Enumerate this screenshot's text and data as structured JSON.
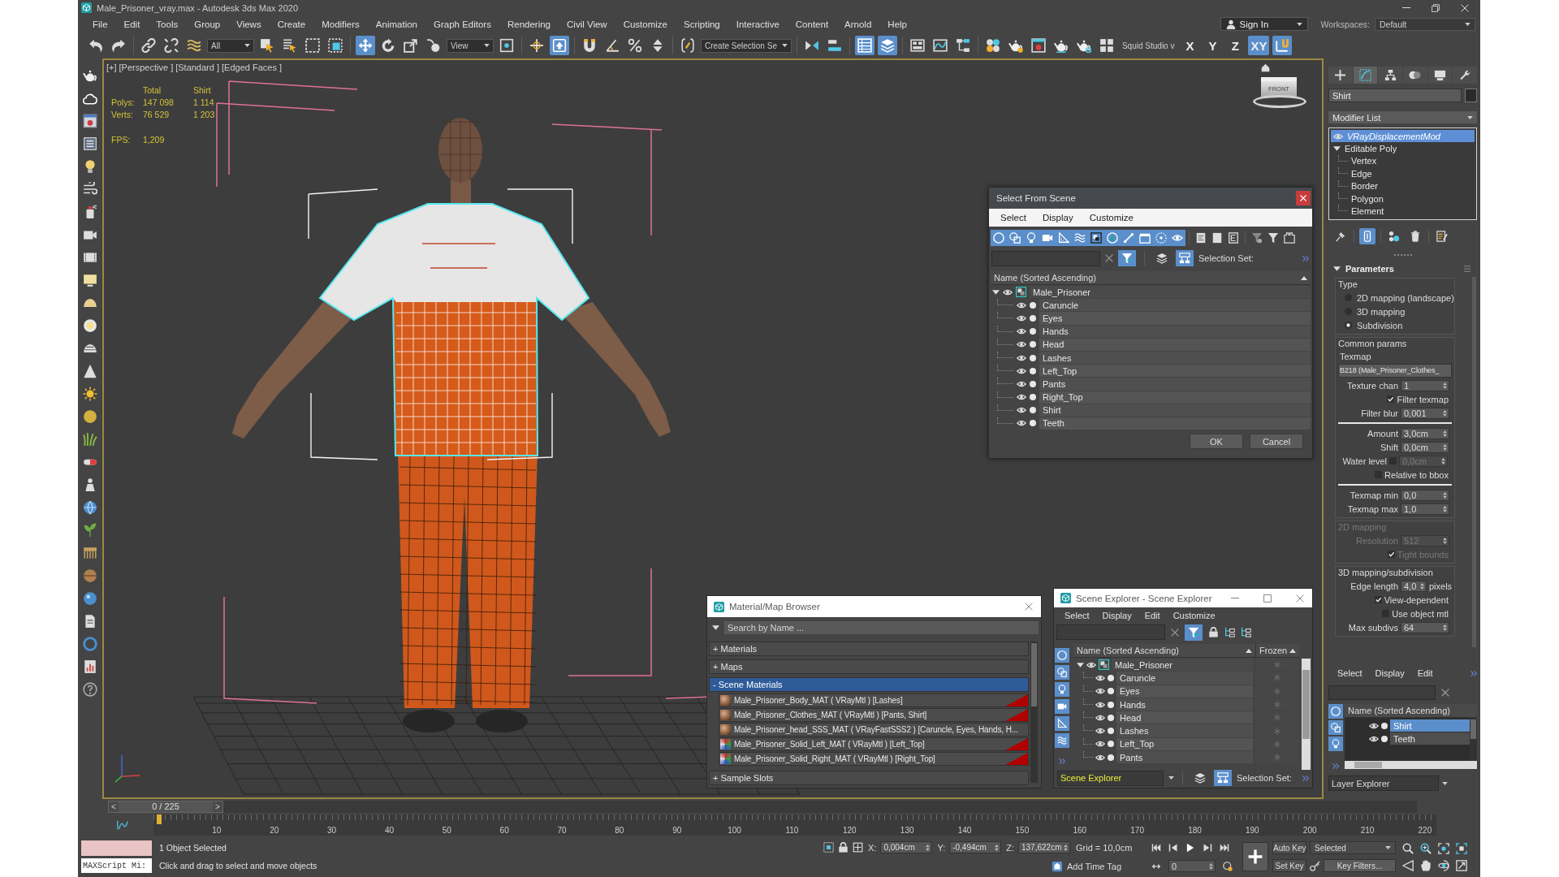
{
  "window": {
    "title": "Male_Prisoner_vray.max - Autodesk 3ds Max 2020"
  },
  "menu": [
    "File",
    "Edit",
    "Tools",
    "Group",
    "Views",
    "Create",
    "Modifiers",
    "Animation",
    "Graph Editors",
    "Rendering",
    "Civil View",
    "Customize",
    "Scripting",
    "Interactive",
    "Content",
    "Arnold",
    "Help"
  ],
  "account": {
    "label": "Sign In"
  },
  "workspaces": {
    "label": "Workspaces:",
    "value": "Default"
  },
  "main_toolbar": [
    {
      "kind": "icon",
      "on": false
    },
    {
      "kind": "icon",
      "on": false
    },
    {
      "kind": "separator"
    },
    {
      "kind": "icon",
      "on": false
    },
    {
      "kind": "icon",
      "on": false
    },
    {
      "kind": "icon",
      "on": false
    },
    {
      "kind": "dropdown",
      "value": "All"
    },
    {
      "kind": "icon",
      "on": false
    },
    {
      "kind": "icon",
      "on": false
    },
    {
      "kind": "icon",
      "on": false
    },
    {
      "kind": "icon",
      "on": false
    },
    {
      "kind": "separator"
    },
    {
      "kind": "icon",
      "on": true
    },
    {
      "kind": "icon",
      "on": false
    },
    {
      "kind": "icon",
      "on": false
    },
    {
      "kind": "icon",
      "on": false
    },
    {
      "kind": "dropdown",
      "value": "View"
    },
    {
      "kind": "icon",
      "on": false
    },
    {
      "kind": "separator"
    },
    {
      "kind": "icon",
      "on": false
    },
    {
      "kind": "icon",
      "on": true
    },
    {
      "kind": "separator"
    },
    {
      "kind": "icon",
      "on": false
    },
    {
      "kind": "icon",
      "on": false
    },
    {
      "kind": "icon",
      "on": false
    },
    {
      "kind": "icon",
      "on": false
    },
    {
      "kind": "separator"
    },
    {
      "kind": "icon",
      "on": false
    },
    {
      "kind": "dropdown",
      "value": "Create Selection Se"
    },
    {
      "kind": "separator"
    },
    {
      "kind": "icon",
      "on": false
    },
    {
      "kind": "icon",
      "on": false
    },
    {
      "kind": "separator"
    },
    {
      "kind": "icon",
      "on": true
    },
    {
      "kind": "icon",
      "on": true
    },
    {
      "kind": "separator"
    },
    {
      "kind": "icon",
      "on": false
    },
    {
      "kind": "icon",
      "on": false
    },
    {
      "kind": "icon",
      "on": false
    },
    {
      "kind": "separator"
    },
    {
      "kind": "icon",
      "on": false
    },
    {
      "kind": "icon",
      "on": false
    },
    {
      "kind": "icon",
      "on": false
    },
    {
      "kind": "icon",
      "on": false
    },
    {
      "kind": "icon",
      "on": false
    },
    {
      "kind": "icon",
      "on": false
    },
    {
      "kind": "label",
      "value": "Squid Studio v"
    },
    {
      "kind": "axis",
      "label": "X",
      "on": false
    },
    {
      "kind": "axis",
      "label": "Y",
      "on": false
    },
    {
      "kind": "axis",
      "label": "Z",
      "on": false
    },
    {
      "kind": "axis",
      "label": "XY",
      "on": true
    },
    {
      "kind": "icon",
      "on": true
    }
  ],
  "viewport": {
    "labels": [
      "[+]",
      "[Perspective ]",
      "[Standard ]",
      "[Edged Faces ]"
    ],
    "stats": {
      "columns": [
        "Total",
        "Shirt"
      ],
      "rows": [
        {
          "label": "Polys:",
          "values": [
            "147 098",
            "1 114"
          ]
        },
        {
          "label": "Verts:",
          "values": [
            "76 529",
            "1 203"
          ]
        }
      ]
    },
    "fps": {
      "label": "FPS:",
      "value": "1,209"
    },
    "viewcube": {
      "face": "FRONT"
    }
  },
  "select_from_scene": {
    "title": "Select From Scene",
    "menu": [
      "Select",
      "Display",
      "Customize"
    ],
    "type_filters": [
      {
        "on": true
      },
      {
        "on": true
      },
      {
        "on": true
      },
      {
        "on": true
      },
      {
        "on": true
      },
      {
        "on": true
      },
      {
        "on": true
      },
      {
        "on": true
      },
      {
        "on": true
      },
      {
        "on": true
      },
      {
        "on": true
      },
      {
        "on": true
      }
    ],
    "find_filter": {
      "on": true
    },
    "hierarchy_view": {
      "on": true
    },
    "selection_set_label": "Selection Set:",
    "column": "Name (Sorted Ascending)",
    "tree": [
      {
        "name": "Male_Prisoner",
        "expanded": true,
        "selected": false,
        "children": [
          {
            "name": "Caruncle",
            "selected": false
          },
          {
            "name": "Eyes",
            "selected": false
          },
          {
            "name": "Hands",
            "selected": false
          },
          {
            "name": "Head",
            "selected": false
          },
          {
            "name": "Lashes",
            "selected": false
          },
          {
            "name": "Left_Top",
            "selected": false
          },
          {
            "name": "Pants",
            "selected": false
          },
          {
            "name": "Right_Top",
            "selected": false
          },
          {
            "name": "Shirt",
            "selected": false
          },
          {
            "name": "Teeth",
            "selected": false
          }
        ]
      }
    ],
    "buttons": [
      "OK",
      "Cancel"
    ]
  },
  "material_browser": {
    "title": "Material/Map Browser",
    "search": {
      "placeholder": "Search by Name ..."
    },
    "groups": [
      {
        "sign": "+",
        "label": "Materials",
        "expanded": false
      },
      {
        "sign": "+",
        "label": "Maps",
        "expanded": false
      },
      {
        "sign": "-",
        "label": "Scene Materials",
        "expanded": true,
        "items": [
          {
            "kind": "sphere",
            "label": "Male_Prisoner_Body_MAT ( VRayMtl ) [Lashes]",
            "hot": true
          },
          {
            "kind": "sphere",
            "label": "Male_Prisoner_Clothes_MAT ( VRayMtl ) [Pants, Shirt]",
            "hot": true
          },
          {
            "kind": "sphere",
            "label": "Male_Prisoner_head_SSS_MAT ( VRayFastSSS2 ) [Caruncle, Eyes, Hands, H...",
            "hot": false
          },
          {
            "kind": "multi",
            "label": "Male_Prisoner_Solid_Left_MAT ( VRayMtl ) [Left_Top]",
            "hot": true
          },
          {
            "kind": "multi",
            "label": "Male_Prisoner_Solid_Right_MAT ( VRayMtl ) [Right_Top]",
            "hot": true
          }
        ]
      },
      {
        "sign": "+",
        "label": "Sample Slots",
        "expanded": false
      }
    ]
  },
  "scene_explorer": {
    "title": "Scene Explorer - Scene Explorer",
    "menu": [
      "Select",
      "Display",
      "Edit",
      "Customize"
    ],
    "find_filter": {
      "on": true
    },
    "side_filters": [
      {
        "on": true
      },
      {
        "on": true
      },
      {
        "on": true
      },
      {
        "on": true
      },
      {
        "on": true
      },
      {
        "on": true
      }
    ],
    "columns": [
      "Name (Sorted Ascending)",
      "Frozen"
    ],
    "tree": [
      {
        "name": "Male_Prisoner",
        "expanded": true,
        "selected": false,
        "frozen": false,
        "children": [
          {
            "name": "Caruncle",
            "selected": false,
            "frozen": false
          },
          {
            "name": "Eyes",
            "selected": false,
            "frozen": false
          },
          {
            "name": "Hands",
            "selected": false,
            "frozen": false
          },
          {
            "name": "Head",
            "selected": false,
            "frozen": false
          },
          {
            "name": "Lashes",
            "selected": false,
            "frozen": false
          },
          {
            "name": "Left_Top",
            "selected": false,
            "frozen": false
          },
          {
            "name": "Pants",
            "selected": false,
            "frozen": false
          }
        ]
      }
    ],
    "explorer": "Scene Explorer",
    "hierarchy_view": {
      "on": true
    },
    "selection_set_label": "Selection Set:"
  },
  "command_panel": {
    "tabs": [
      {
        "selected": false
      },
      {
        "selected": true
      },
      {
        "selected": false
      },
      {
        "selected": false
      },
      {
        "selected": false
      },
      {
        "selected": false
      }
    ],
    "object_name": "Shirt",
    "modifier_list": "Modifier List",
    "stack": [
      {
        "kind": "modifier",
        "label": "VRayDisplacementMod",
        "selected": true
      },
      {
        "kind": "object",
        "label": "Editable Poly",
        "selected": false,
        "expanded": true,
        "children": [
          {
            "label": "Vertex",
            "selected": false
          },
          {
            "label": "Edge",
            "selected": false
          },
          {
            "label": "Border",
            "selected": false
          },
          {
            "label": "Polygon",
            "selected": false
          },
          {
            "label": "Element",
            "selected": false
          }
        ]
      }
    ],
    "stack_tools": [
      {
        "on": false
      },
      {
        "on": true
      },
      {
        "on": false
      },
      {
        "on": false
      },
      {
        "on": false
      }
    ],
    "rollout": {
      "title": "Parameters",
      "expanded": true,
      "groups": [
        {
          "title": "Type",
          "disabled": false,
          "rows": [
            {
              "kind": "radio",
              "label": "2D mapping (landscape)",
              "selected": false
            },
            {
              "kind": "radio",
              "label": "3D mapping",
              "selected": false
            },
            {
              "kind": "radio",
              "label": "Subdivision",
              "selected": true
            }
          ]
        },
        {
          "title": "Common params",
          "disabled": false,
          "rows": [
            {
              "kind": "label",
              "label": "Texmap"
            },
            {
              "kind": "map",
              "value": "B218 (Male_Prisoner_Clothes_"
            },
            {
              "kind": "spinner",
              "label": "Texture chan",
              "value": "1"
            },
            {
              "kind": "checkbox",
              "label": "Filter texmap",
              "checked": true
            },
            {
              "kind": "spinner",
              "label": "Filter blur",
              "value": "0,001"
            },
            {
              "kind": "rule"
            },
            {
              "kind": "spinner",
              "label": "Amount",
              "value": "3,0cm"
            },
            {
              "kind": "spinner",
              "label": "Shift",
              "value": "0,0cm"
            },
            {
              "kind": "check_spinner",
              "label": "Water level",
              "checked": false,
              "value": "0,0cm"
            },
            {
              "kind": "checkbox",
              "label": "Relative to bbox",
              "checked": false
            },
            {
              "kind": "rule"
            },
            {
              "kind": "spinner",
              "label": "Texmap min",
              "value": "0,0"
            },
            {
              "kind": "spinner",
              "label": "Texmap max",
              "value": "1,0"
            }
          ]
        },
        {
          "title": "2D mapping",
          "disabled": true,
          "rows": [
            {
              "kind": "spinner",
              "label": "Resolution",
              "value": "512"
            },
            {
              "kind": "checkbox",
              "label": "Tight bounds",
              "checked": true
            }
          ]
        },
        {
          "title": "3D mapping/subdivision",
          "disabled": false,
          "rows": [
            {
              "kind": "spinner",
              "label": "Edge length",
              "value": "4,0",
              "unit": "pixels"
            },
            {
              "kind": "checkbox",
              "label": "View-dependent",
              "checked": true
            },
            {
              "kind": "checkbox",
              "label": "Use object mtl",
              "checked": false
            },
            {
              "kind": "spinner",
              "label": "Max subdivs",
              "value": "64"
            }
          ]
        }
      ]
    }
  },
  "layer_explorer": {
    "menu": [
      "Select",
      "Display",
      "Edit"
    ],
    "side_filters": [
      {
        "on": true
      },
      {
        "on": true
      },
      {
        "on": true
      }
    ],
    "column": "Name (Sorted Ascending)",
    "rows": [
      {
        "name": "Shirt",
        "selected": true
      },
      {
        "name": "Teeth",
        "selected": false
      }
    ],
    "explorer": "Layer Explorer"
  },
  "time_slider": {
    "prev": "<",
    "label": "0 / 225",
    "next": ">",
    "level": 0
  },
  "track_bar": {
    "labels": [
      "10",
      "20",
      "30",
      "40",
      "50",
      "60",
      "70",
      "80",
      "90",
      "100",
      "110",
      "120",
      "130",
      "140",
      "150",
      "160",
      "170",
      "180",
      "190",
      "200",
      "210",
      "220"
    ]
  },
  "status_bar": {
    "maxscript": "MAXScript Mi:",
    "selection": "1 Object Selected",
    "prompt": "Click and drag to select and move objects",
    "coords": [
      {
        "label": "X:",
        "value": "0,004cm"
      },
      {
        "label": "Y:",
        "value": "-0,494cm"
      },
      {
        "label": "Z:",
        "value": "137,622cm"
      }
    ],
    "grid": "Grid = 10,0cm",
    "time_tag": "Add Time Tag",
    "frame": "0",
    "auto_key": {
      "label": "Auto Key",
      "on": false
    },
    "key_mode": "Selected",
    "set_key": "Set Key",
    "key_filters": "Key Filters..."
  }
}
